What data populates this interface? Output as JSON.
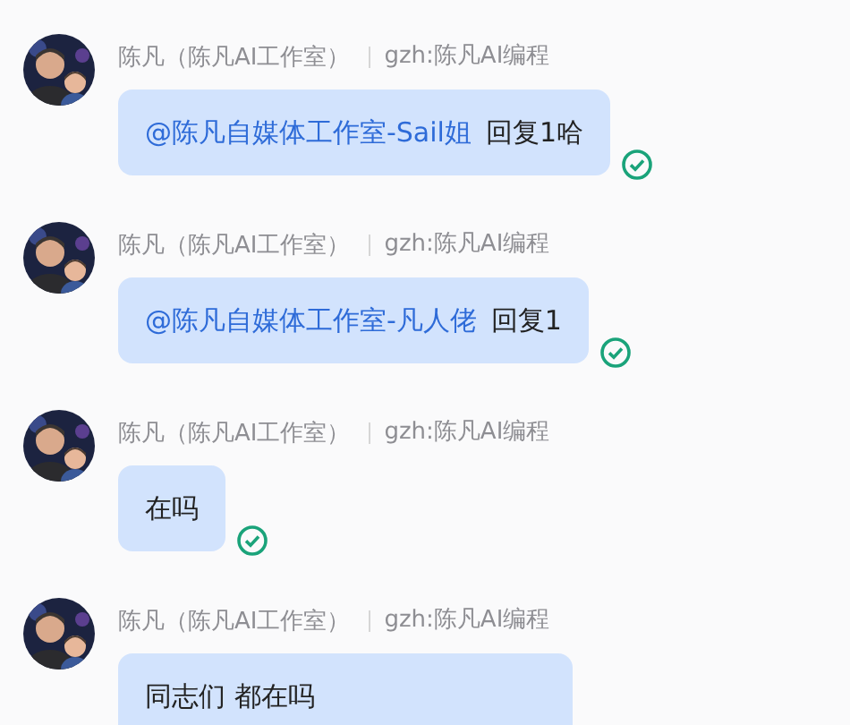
{
  "messages": [
    {
      "sender": "陈凡（陈凡AI工作室）",
      "account": "gzh:陈凡AI编程",
      "parts": [
        {
          "kind": "mention",
          "text": "@陈凡自媒体工作室-Sail姐"
        },
        {
          "kind": "text",
          "text": "回复1哈"
        }
      ],
      "read": true
    },
    {
      "sender": "陈凡（陈凡AI工作室）",
      "account": "gzh:陈凡AI编程",
      "parts": [
        {
          "kind": "mention",
          "text": "@陈凡自媒体工作室-凡人佬"
        },
        {
          "kind": "text",
          "text": "回复1"
        }
      ],
      "read": true
    },
    {
      "sender": "陈凡（陈凡AI工作室）",
      "account": "gzh:陈凡AI编程",
      "parts": [
        {
          "kind": "text",
          "text": "在吗"
        }
      ],
      "read": true
    },
    {
      "sender": "陈凡（陈凡AI工作室）",
      "account": "gzh:陈凡AI编程",
      "parts": [
        {
          "kind": "text",
          "text": "同志们 都在吗"
        }
      ]
    }
  ]
}
